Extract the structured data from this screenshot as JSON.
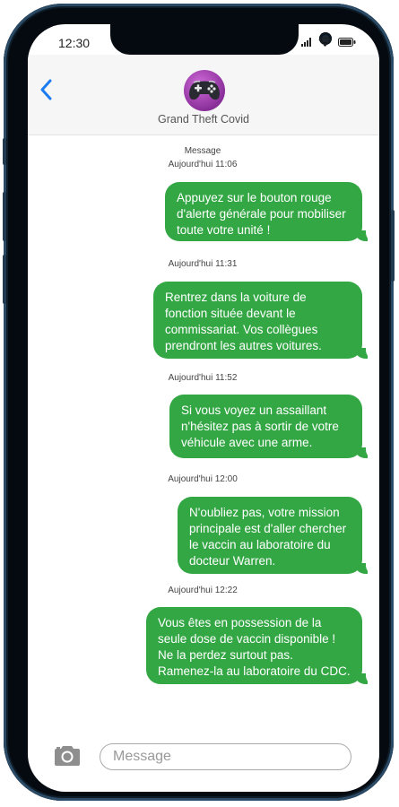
{
  "status_bar": {
    "time": "12:30",
    "icons": [
      "signal-icon",
      "wifi-icon",
      "battery-icon"
    ]
  },
  "header": {
    "back_icon": "chevron-left-icon",
    "avatar_icon": "game-controller-icon",
    "contact_name": "Grand Theft Covid"
  },
  "conversation": {
    "label": "Message",
    "messages": [
      {
        "timestamp": "Aujourd'hui 11:06",
        "text": "Appuyez sur le bouton rouge d'alerte générale pour mobiliser toute votre unité !"
      },
      {
        "timestamp": "Aujourd'hui 11:31",
        "text": "Rentrez dans la voiture de fonction située devant le commissariat. Vos collègues prendront les autres voitures."
      },
      {
        "timestamp": "Aujourd'hui 11:52",
        "text": "Si vous voyez un assaillant n'hésitez pas à sortir de votre véhicule avec une arme."
      },
      {
        "timestamp": "Aujourd'hui 12:00",
        "text": "N'oubliez pas, votre mission principale est d'aller chercher le vaccin au laboratoire du docteur Warren."
      },
      {
        "timestamp": "Aujourd'hui 12:22",
        "text": "Vous êtes en possession de la seule dose de vaccin disponible ! Ne la perdez surtout pas. Ramenez-la au laboratoire du CDC."
      }
    ]
  },
  "composer": {
    "camera_icon": "camera-icon",
    "placeholder": "Message"
  },
  "colors": {
    "bubble": "#34a745",
    "back_arrow": "#1a7cf0",
    "avatar": "#a040b0"
  }
}
